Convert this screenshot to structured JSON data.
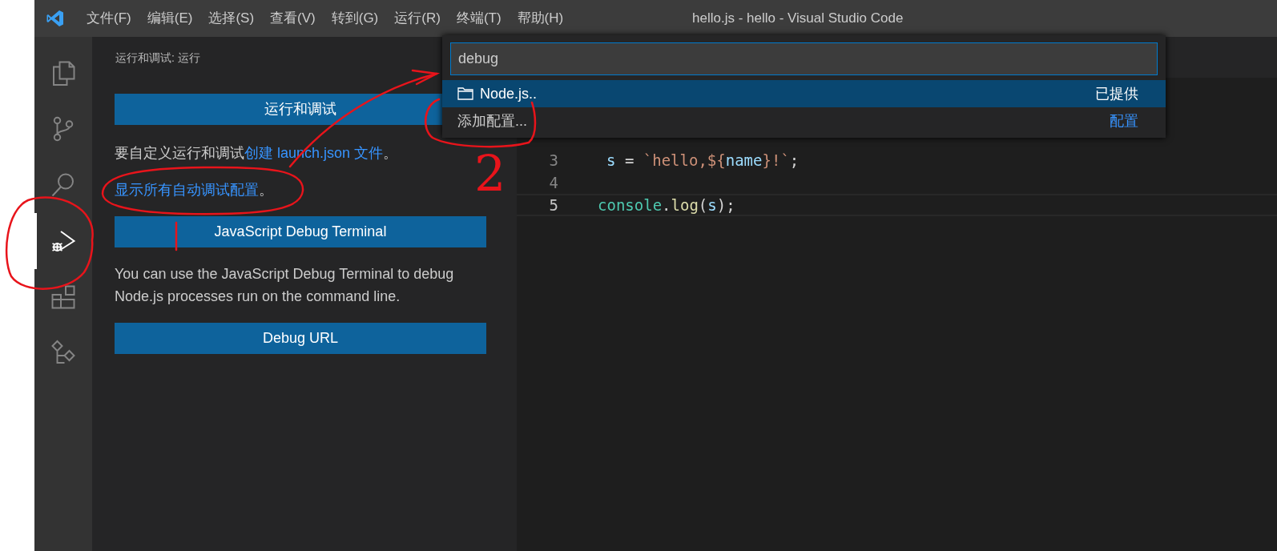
{
  "window": {
    "title": "hello.js - hello - Visual Studio Code"
  },
  "menu": [
    "文件(F)",
    "编辑(E)",
    "选择(S)",
    "查看(V)",
    "转到(G)",
    "运行(R)",
    "终端(T)",
    "帮助(H)"
  ],
  "activity_bar": [
    {
      "kind": "files",
      "selected": false
    },
    {
      "kind": "branch",
      "selected": false
    },
    {
      "kind": "search",
      "selected": false
    },
    {
      "kind": "debug",
      "selected": true
    },
    {
      "kind": "extensions",
      "selected": false
    },
    {
      "kind": "tree",
      "selected": false
    }
  ],
  "sidebar": {
    "title": "运行和调试: 运行",
    "content": [
      {
        "kind": "button",
        "text": "运行和调试"
      },
      {
        "kind": "text",
        "parts": [
          {
            "text": "要自定义运行和调试",
            "link": false
          },
          {
            "text": "创建 launch.json 文件",
            "link": true
          },
          {
            "text": "。",
            "link": false
          }
        ]
      },
      {
        "kind": "text",
        "parts": [
          {
            "text": "显示所有自动调试配置",
            "link": true
          },
          {
            "text": "。",
            "link": false
          }
        ]
      },
      {
        "kind": "button",
        "text": "JavaScript Debug Terminal"
      },
      {
        "kind": "paragraph",
        "text": "You can use the JavaScript Debug Terminal to debug Node.js processes run on the command line."
      },
      {
        "kind": "button",
        "text": "Debug URL"
      }
    ]
  },
  "editor": {
    "lines": [
      {
        "number": "3",
        "current": false,
        "tokens": [
          {
            "text": "s",
            "kind": "variable"
          },
          {
            "text": " = ",
            "kind": "plain"
          },
          {
            "text": "`hello,${",
            "kind": "string"
          },
          {
            "text": "name",
            "kind": "variable"
          },
          {
            "text": "}!`",
            "kind": "string"
          },
          {
            "text": ";",
            "kind": "plain"
          }
        ]
      },
      {
        "number": "4",
        "current": false
      },
      {
        "number": "5",
        "current": true,
        "tokens": [
          {
            "text": "console",
            "kind": "class"
          },
          {
            "text": ".",
            "kind": "plain"
          },
          {
            "text": "log",
            "kind": "function"
          },
          {
            "text": "(",
            "kind": "plain"
          },
          {
            "text": "s",
            "kind": "variable"
          },
          {
            "text": ");",
            "kind": "plain"
          }
        ]
      }
    ]
  },
  "quick_pick": {
    "value": "debug",
    "items": [
      {
        "label": "Node.js..",
        "detail": "已提供",
        "detail_link": false,
        "icon": true,
        "selected": true
      },
      {
        "label": "添加配置...",
        "detail": "配置",
        "detail_link": true,
        "icon": false,
        "selected": false
      }
    ]
  },
  "annotations": {
    "number": "2"
  }
}
